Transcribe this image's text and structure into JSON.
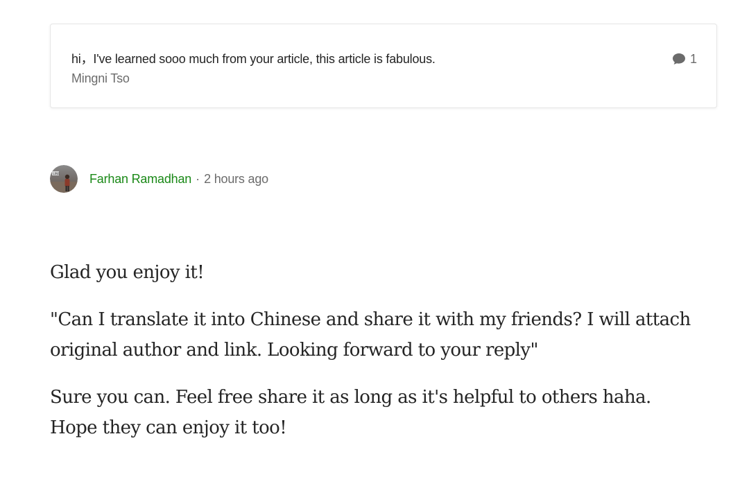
{
  "parent_comment": {
    "text": "hi，I've learned sooo much from your article, this article is fabulous.",
    "author": "Mingni Tso",
    "reply_count": "1",
    "reply_icon": "speech-bubble-icon"
  },
  "reply": {
    "avatar_icon": "user-avatar",
    "author": "Farhan Ramadhan",
    "separator": "·",
    "timestamp": "2 hours ago",
    "author_color": "#1a8917",
    "paragraphs": [
      "Glad you enjoy it!",
      "\"Can I translate it into Chinese and share it with my friends? I will attach original author and link. Looking forward to your reply\"",
      "Sure you can. Feel free share it as long as it's helpful to others haha. Hope they can enjoy it too!"
    ]
  }
}
